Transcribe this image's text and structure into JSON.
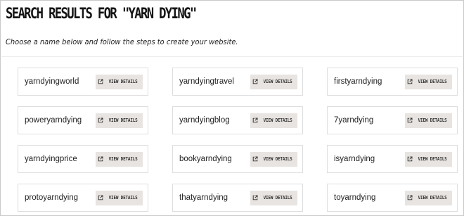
{
  "page": {
    "title": "SEARCH RESULTS FOR \"YARN DYING\"",
    "subtitle": "Choose a name below and follow the steps to create your website."
  },
  "results": [
    {
      "name": "yarndyingworld",
      "button_label": "VIEW DETAILS",
      "icon": "external-link-icon"
    },
    {
      "name": "yarndyingtravel",
      "button_label": "VIEW DETAILS",
      "icon": "external-link-icon"
    },
    {
      "name": "firstyarndying",
      "button_label": "VIEW DETAILS",
      "icon": "external-link-icon"
    },
    {
      "name": "poweryarndying",
      "button_label": "VIEW DETAILS",
      "icon": "external-link-icon"
    },
    {
      "name": "yarndyingblog",
      "button_label": "VIEW DETAILS",
      "icon": "external-link-icon"
    },
    {
      "name": "7yarndying",
      "button_label": "VIEW DETAILS",
      "icon": "external-link-icon"
    },
    {
      "name": "yarndyingprice",
      "button_label": "VIEW DETAILS",
      "icon": "external-link-icon"
    },
    {
      "name": "bookyarndying",
      "button_label": "VIEW DETAILS",
      "icon": "external-link-icon"
    },
    {
      "name": "isyarndying",
      "button_label": "VIEW DETAILS",
      "icon": "external-link-icon"
    },
    {
      "name": "protoyarndying",
      "button_label": "VIEW DETAILS",
      "icon": "external-link-icon"
    },
    {
      "name": "thatyarndying",
      "button_label": "VIEW DETAILS",
      "icon": "external-link-icon"
    },
    {
      "name": "toyarndying",
      "button_label": "VIEW DETAILS",
      "icon": "external-link-icon"
    }
  ],
  "colors": {
    "button_bg": "#e8e4e1",
    "card_border": "#dedede",
    "text": "#222222"
  }
}
